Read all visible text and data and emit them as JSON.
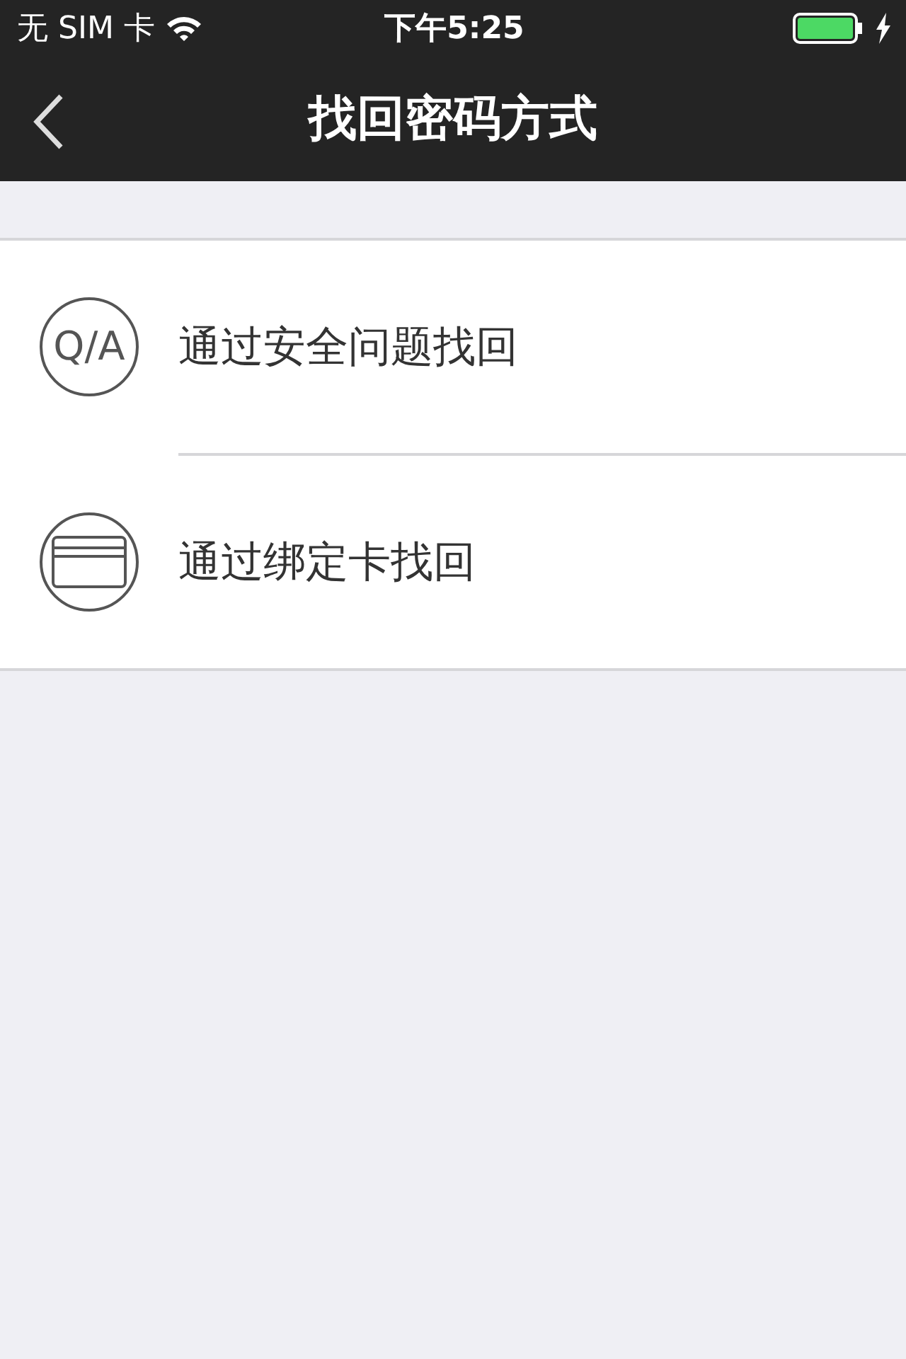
{
  "status_bar": {
    "carrier": "无 SIM 卡",
    "time": "下午5:25"
  },
  "nav_bar": {
    "title": "找回密码方式"
  },
  "options": [
    {
      "kind": "qa",
      "icon_text": "Q/A",
      "label": "通过安全问题找回"
    },
    {
      "kind": "card",
      "label": "通过绑定卡找回"
    }
  ]
}
